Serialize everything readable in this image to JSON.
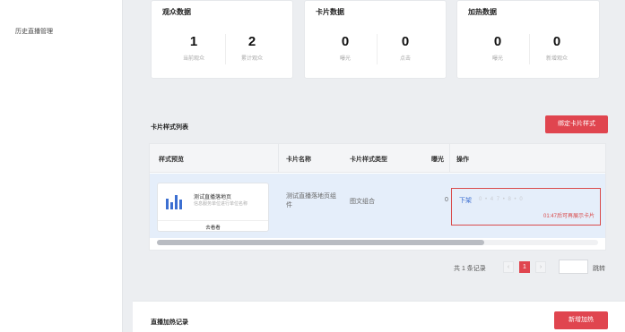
{
  "sidebar": {
    "items": [
      {
        "label": "历史直播管理"
      }
    ]
  },
  "stats_cards": [
    {
      "title": "观众数据",
      "metrics": [
        {
          "value": "1",
          "label": "当前观众"
        },
        {
          "value": "2",
          "label": "累计观众"
        }
      ]
    },
    {
      "title": "卡片数据",
      "metrics": [
        {
          "value": "0",
          "label": "曝光"
        },
        {
          "value": "0",
          "label": "点击"
        }
      ]
    },
    {
      "title": "加热数据",
      "metrics": [
        {
          "value": "0",
          "label": "曝光"
        },
        {
          "value": "0",
          "label": "新增观众"
        }
      ]
    }
  ],
  "card_list": {
    "title": "卡片样式列表",
    "bind_button": "绑定卡片样式",
    "columns": [
      "样式预览",
      "卡片名称",
      "卡片样式类型",
      "曝光",
      "操作"
    ],
    "rows": [
      {
        "preview": {
          "title": "测试直播落地页",
          "subtitle": "信息服务单位进行单位名称",
          "link": "去看看"
        },
        "name": "测试直播落地页组件",
        "type": "图文组合",
        "exposure": "0",
        "action": "下架",
        "faded_actions": "0 • 4 7  • 8  •  0",
        "note": "01:47后可再展示卡片"
      }
    ]
  },
  "pagination": {
    "total": "共 1 条记录",
    "prev": "‹",
    "current": "1",
    "next": "›",
    "jump": "跳转"
  },
  "heating": {
    "title": "直播加热记录",
    "add_button": "新增加热"
  },
  "colors": {
    "brand_red": "#e0454f",
    "link_blue": "#3c6fd1",
    "row_highlight": "#e5eefa"
  }
}
